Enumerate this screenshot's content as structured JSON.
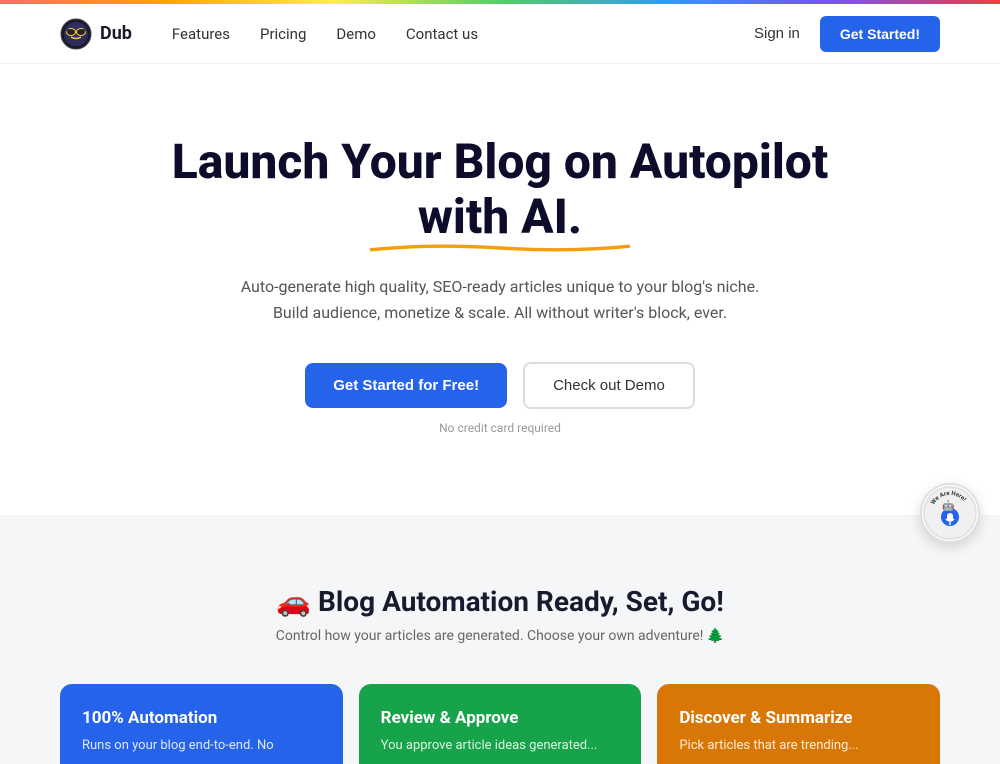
{
  "rainbow_bar": {},
  "navbar": {
    "brand_name": "Dub",
    "nav_links": [
      {
        "label": "Features",
        "id": "features"
      },
      {
        "label": "Pricing",
        "id": "pricing"
      },
      {
        "label": "Demo",
        "id": "demo"
      },
      {
        "label": "Contact us",
        "id": "contact"
      }
    ],
    "sign_in_label": "Sign in",
    "get_started_label": "Get Started!"
  },
  "hero": {
    "title_line1": "Launch Your Blog on Autopilot with AI.",
    "subtitle": "Auto-generate high quality, SEO-ready articles unique to your blog's niche.\nBuild audience, monetize & scale. All without writer's block, ever.",
    "btn_primary_label": "Get Started for Free!",
    "btn_secondary_label": "Check out Demo",
    "no_cc_label": "No credit card required"
  },
  "features_section": {
    "title": "🚗 Blog Automation Ready, Set, Go!",
    "subtitle": "Control how your articles are generated. Choose your own adventure! 🌲",
    "cards": [
      {
        "id": "automation",
        "title": "100% Automation",
        "description": "Runs on your blog end-to-end. No",
        "color": "blue"
      },
      {
        "id": "review",
        "title": "Review & Approve",
        "description": "You approve article ideas generated...",
        "color": "green"
      },
      {
        "id": "discover",
        "title": "Discover & Summarize",
        "description": "Pick articles that are trending...",
        "color": "yellow"
      }
    ]
  },
  "chat_bubble": {
    "we_are_here": "We Are\nHere!"
  }
}
